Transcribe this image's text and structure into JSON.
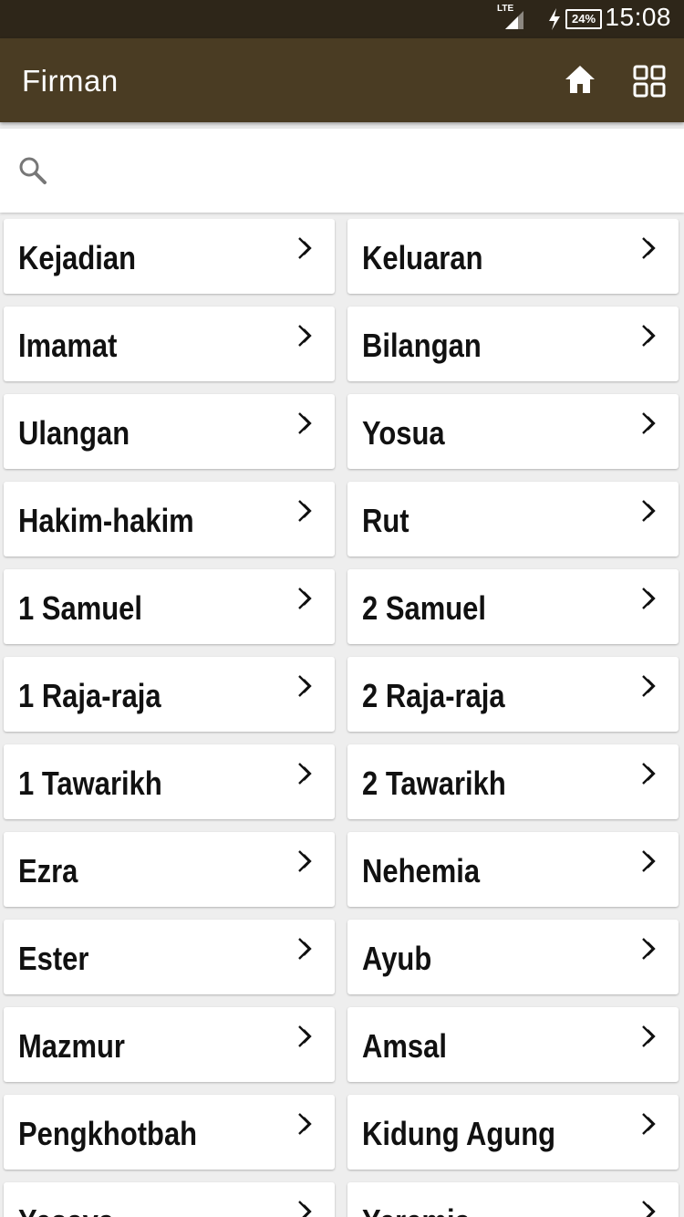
{
  "status_bar": {
    "network": "LTE",
    "battery": "24%",
    "time": "15:08"
  },
  "app_bar": {
    "title": "Firman",
    "icons": [
      "home-icon",
      "grid-view-icon"
    ]
  },
  "search": {
    "placeholder": "",
    "icon": "search-icon"
  },
  "books": [
    {
      "label": "Kejadian"
    },
    {
      "label": "Keluaran"
    },
    {
      "label": "Imamat"
    },
    {
      "label": "Bilangan"
    },
    {
      "label": "Ulangan"
    },
    {
      "label": "Yosua"
    },
    {
      "label": "Hakim-hakim"
    },
    {
      "label": "Rut"
    },
    {
      "label": "1 Samuel"
    },
    {
      "label": "2 Samuel"
    },
    {
      "label": "1 Raja-raja"
    },
    {
      "label": "2 Raja-raja"
    },
    {
      "label": "1 Tawarikh"
    },
    {
      "label": "2 Tawarikh"
    },
    {
      "label": "Ezra"
    },
    {
      "label": "Nehemia"
    },
    {
      "label": "Ester"
    },
    {
      "label": "Ayub"
    },
    {
      "label": "Mazmur"
    },
    {
      "label": "Amsal"
    },
    {
      "label": "Pengkhotbah"
    },
    {
      "label": "Kidung Agung"
    },
    {
      "label": "Yesaya"
    },
    {
      "label": "Yeremia"
    }
  ]
}
